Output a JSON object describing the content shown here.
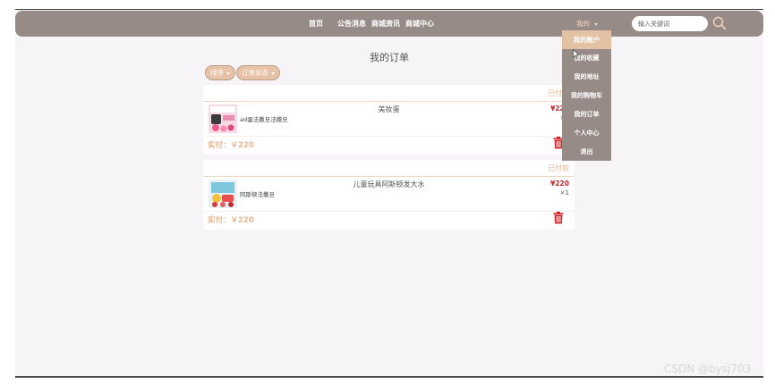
{
  "nav": {
    "links": [
      "首页",
      "公告消息",
      "商城资讯",
      "商城中心"
    ],
    "mine_label": "我的",
    "search_placeholder": "输入关键词"
  },
  "dropdown": {
    "items": [
      "我的账户",
      "我的收藏",
      "我的地址",
      "我的购物车",
      "我的订单",
      "个人中心",
      "退出"
    ]
  },
  "page": {
    "title": "我的订单"
  },
  "filters": {
    "sort_label": "排序",
    "status_label": "订单状态"
  },
  "orders": [
    {
      "status": "已付款",
      "name": "美妆蛋",
      "desc": "ad蛋法撒旦法撒旦",
      "price": "¥220",
      "qty": "×1",
      "paid": "实付：￥220"
    },
    {
      "status": "已付款",
      "name": "儿童玩具阿斯顿发大水",
      "desc": "阿斯顿法撒旦",
      "price": "¥220",
      "qty": "×1",
      "paid": "实付：￥220"
    }
  ],
  "icons": {
    "search": "search-icon",
    "trash": "trash-icon",
    "caret": "caret-down-icon"
  },
  "colors": {
    "navbar": "#978b88",
    "accent": "#e8b693",
    "price": "#c0272d",
    "active_menu": "#e3c1a4"
  },
  "watermark": "CSDN @bysj703"
}
